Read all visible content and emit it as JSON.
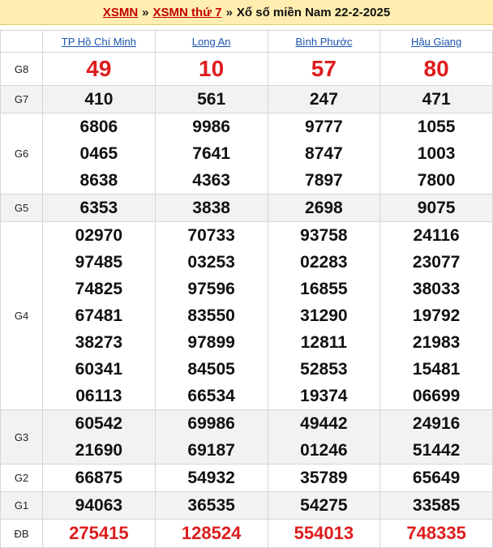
{
  "header": {
    "link1": "XSMN",
    "sep1": "»",
    "link2": "XSMN thứ 7",
    "sep2": "»",
    "title": "Xổ số miền Nam 22-2-2025"
  },
  "provinces": [
    "TP Hồ Chí Minh",
    "Long An",
    "Bình Phước",
    "Hậu Giang"
  ],
  "prizes": [
    {
      "label": "G8",
      "values": [
        [
          "49"
        ],
        [
          "10"
        ],
        [
          "57"
        ],
        [
          "80"
        ]
      ]
    },
    {
      "label": "G7",
      "values": [
        [
          "410"
        ],
        [
          "561"
        ],
        [
          "247"
        ],
        [
          "471"
        ]
      ]
    },
    {
      "label": "G6",
      "values": [
        [
          "6806",
          "0465",
          "8638"
        ],
        [
          "9986",
          "7641",
          "4363"
        ],
        [
          "9777",
          "8747",
          "7897"
        ],
        [
          "1055",
          "1003",
          "7800"
        ]
      ]
    },
    {
      "label": "G5",
      "values": [
        [
          "6353"
        ],
        [
          "3838"
        ],
        [
          "2698"
        ],
        [
          "9075"
        ]
      ]
    },
    {
      "label": "G4",
      "values": [
        [
          "02970",
          "97485",
          "74825",
          "67481",
          "38273",
          "60341",
          "06113"
        ],
        [
          "70733",
          "03253",
          "97596",
          "83550",
          "97899",
          "84505",
          "66534"
        ],
        [
          "93758",
          "02283",
          "16855",
          "31290",
          "12811",
          "52853",
          "19374"
        ],
        [
          "24116",
          "23077",
          "38033",
          "19792",
          "21983",
          "15481",
          "06699"
        ]
      ]
    },
    {
      "label": "G3",
      "values": [
        [
          "60542",
          "21690"
        ],
        [
          "69986",
          "69187"
        ],
        [
          "49442",
          "01246"
        ],
        [
          "24916",
          "51442"
        ]
      ]
    },
    {
      "label": "G2",
      "values": [
        [
          "66875"
        ],
        [
          "54932"
        ],
        [
          "35789"
        ],
        [
          "65649"
        ]
      ]
    },
    {
      "label": "G1",
      "values": [
        [
          "94063"
        ],
        [
          "36535"
        ],
        [
          "54275"
        ],
        [
          "33585"
        ]
      ]
    },
    {
      "label": "ĐB",
      "values": [
        [
          "275415"
        ],
        [
          "128524"
        ],
        [
          "554013"
        ],
        [
          "748335"
        ]
      ]
    }
  ]
}
